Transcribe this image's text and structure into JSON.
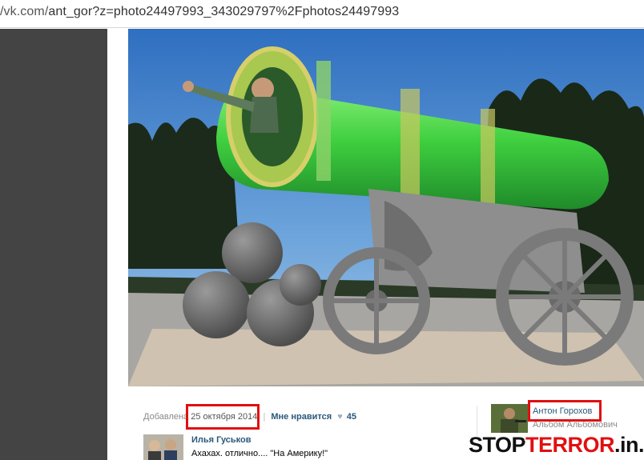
{
  "browser": {
    "url_prefix": "/vk.com/",
    "url_rest": "ant_gor?z=photo24497993_343029797%2Fphotos24497993"
  },
  "photo": {
    "subject": "Tsar Cannon with person in barrel"
  },
  "info": {
    "added_label": "Добавлена",
    "date": "25 октября 2014",
    "separator": "|",
    "like_label": "Мне нравится",
    "like_count": "45"
  },
  "owner": {
    "name": "Антон Горохов",
    "album": "Альбом Альбомович"
  },
  "comment": {
    "author": "Илья Гуськов",
    "text": "Ахахах. отлично.... \"На Америку!\""
  },
  "watermark": {
    "part1": "STOP",
    "part2": "TERROR",
    "part3": ".in.ua"
  },
  "colors": {
    "highlight_box": "#e01010",
    "link": "#2b587a",
    "cannon_green": "#3fcf3f"
  }
}
